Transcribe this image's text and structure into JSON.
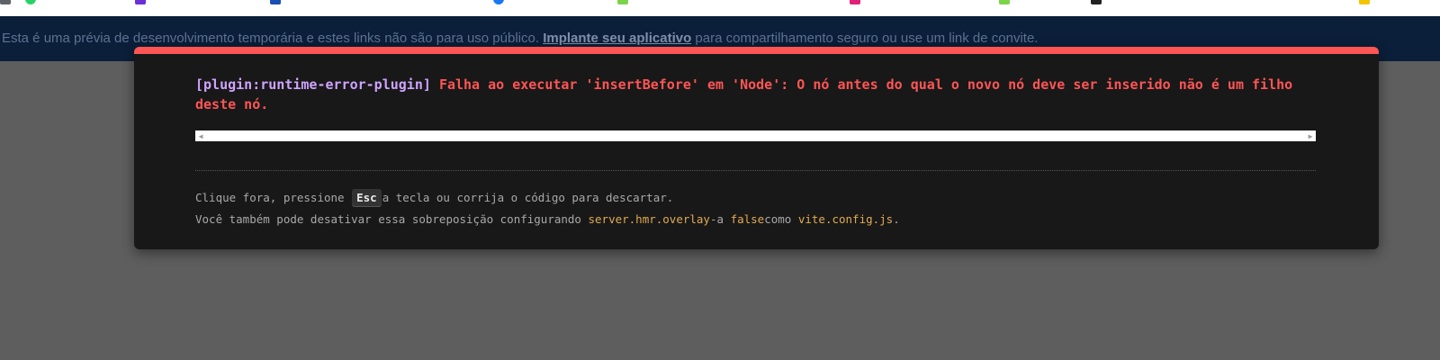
{
  "bookmarks": [
    "",
    "",
    "",
    "",
    "",
    "",
    "",
    "",
    "",
    ""
  ],
  "preview_banner": {
    "text_before": "Esta é uma prévia de desenvolvimento temporária e estes links não são para uso público.",
    "link": "Implante seu aplicativo",
    "text_after": "para compartilhamento seguro ou use um link de convite."
  },
  "error_overlay": {
    "plugin": "[plugin:runtime-error-plugin]",
    "message": "Falha ao executar 'insertBefore' em 'Node': O nó antes do qual o novo nó deve ser inserido não é um filho deste nó.",
    "tip1": {
      "before": "Clique fora, pressione",
      "key": "Esc",
      "after": "a tecla ou corrija o código para descartar."
    },
    "tip2": {
      "part1": "Você também pode desativar essa sobreposição configurando",
      "code1": "server.hmr.overlay",
      "part2": "-a",
      "code2": "false",
      "part3": "como",
      "code3": "vite.config.js",
      "part4": "."
    }
  },
  "colors": {
    "error": "#ff5555",
    "plugin": "#cfa3ff",
    "code": "#e2aa53",
    "banner_bg": "#0b1f3a"
  }
}
